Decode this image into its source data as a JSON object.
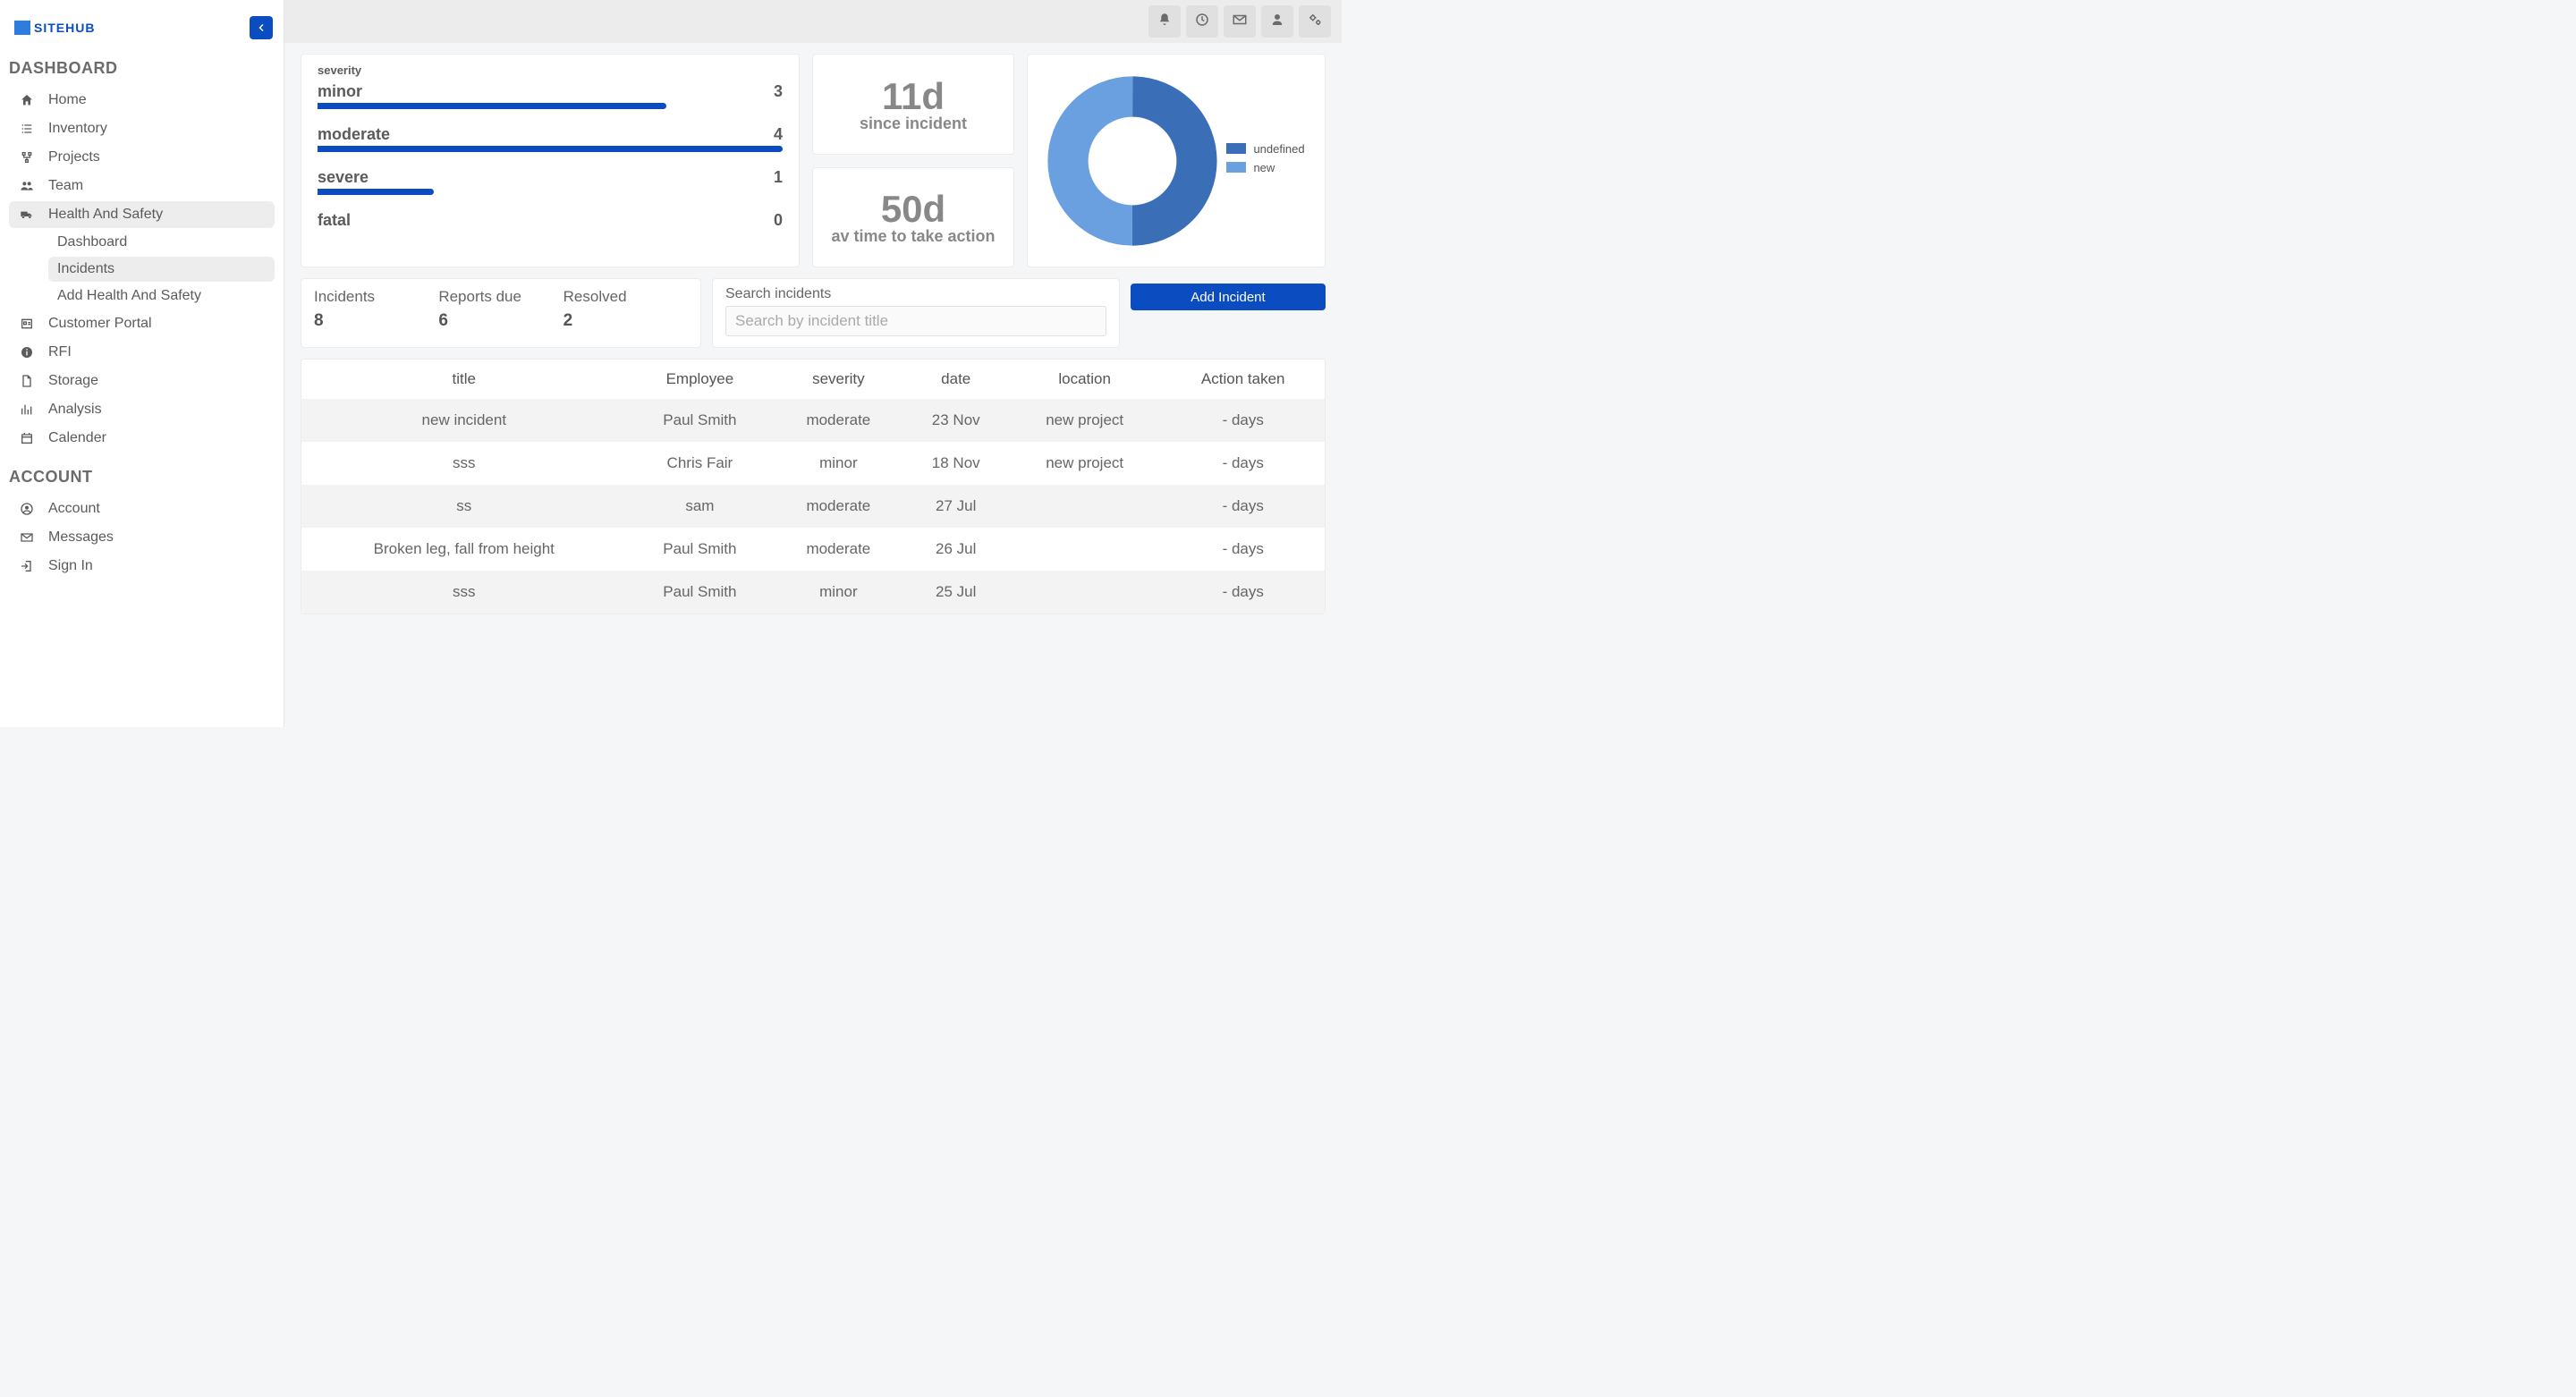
{
  "brand": "SITEHUB",
  "sidebar": {
    "section_dashboard": "DASHBOARD",
    "section_account": "ACCOUNT",
    "items": [
      {
        "label": "Home",
        "icon": "home"
      },
      {
        "label": "Inventory",
        "icon": "list"
      },
      {
        "label": "Projects",
        "icon": "diagram"
      },
      {
        "label": "Team",
        "icon": "users"
      },
      {
        "label": "Health And Safety",
        "icon": "truck",
        "active": true,
        "children": [
          {
            "label": "Dashboard"
          },
          {
            "label": "Incidents",
            "active": true
          },
          {
            "label": "Add Health And Safety"
          }
        ]
      },
      {
        "label": "Customer Portal",
        "icon": "id"
      },
      {
        "label": "RFI",
        "icon": "info"
      },
      {
        "label": "Storage",
        "icon": "file"
      },
      {
        "label": "Analysis",
        "icon": "bars"
      },
      {
        "label": "Calender",
        "icon": "calendar"
      }
    ],
    "account_items": [
      {
        "label": "Account",
        "icon": "user-circle"
      },
      {
        "label": "Messages",
        "icon": "mail"
      },
      {
        "label": "Sign In",
        "icon": "signin"
      }
    ]
  },
  "topbar_icons": [
    "bell",
    "clock",
    "mail",
    "user",
    "cogs"
  ],
  "chart_data": [
    {
      "type": "bar",
      "title": "severity",
      "orientation": "horizontal",
      "categories": [
        "minor",
        "moderate",
        "severe",
        "fatal"
      ],
      "values": [
        3,
        4,
        1,
        0
      ],
      "max": 4,
      "color": "#0b4cc0"
    },
    {
      "type": "pie",
      "variant": "donut",
      "series": [
        {
          "name": "undefined",
          "value": 50,
          "color": "#3a6fb8"
        },
        {
          "name": "new",
          "value": 50,
          "color": "#6a9fe0"
        }
      ]
    }
  ],
  "kpis": [
    {
      "value": "11d",
      "label": "since incident"
    },
    {
      "value": "50d",
      "label": "av time to take action"
    }
  ],
  "stats": {
    "incidents": {
      "label": "Incidents",
      "value": "8"
    },
    "reports_due": {
      "label": "Reports due",
      "value": "6"
    },
    "resolved": {
      "label": "Resolved",
      "value": "2"
    }
  },
  "search": {
    "label": "Search incidents",
    "placeholder": "Search by incident title"
  },
  "add_button": "Add Incident",
  "table": {
    "headers": [
      "title",
      "Employee",
      "severity",
      "date",
      "location",
      "Action taken"
    ],
    "rows": [
      [
        "new incident",
        "Paul Smith",
        "moderate",
        "23 Nov",
        "new project",
        "- days"
      ],
      [
        "sss",
        "Chris Fair",
        "minor",
        "18 Nov",
        "new project",
        "- days"
      ],
      [
        "ss",
        "sam",
        "moderate",
        "27 Jul",
        "",
        "- days"
      ],
      [
        "Broken leg, fall from height",
        "Paul Smith",
        "moderate",
        "26 Jul",
        "",
        "- days"
      ],
      [
        "sss",
        "Paul Smith",
        "minor",
        "25 Jul",
        "",
        "- days"
      ]
    ]
  }
}
